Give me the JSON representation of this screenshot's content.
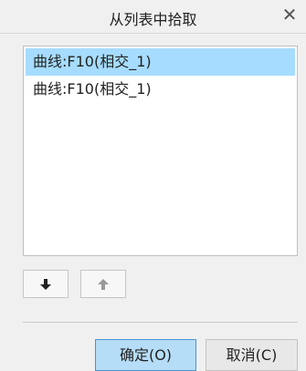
{
  "window": {
    "title": "从列表中拾取",
    "close_icon": "close-icon"
  },
  "list": {
    "items": [
      {
        "label": "曲线:F10(相交_1)",
        "selected": true
      },
      {
        "label": "曲线:F10(相交_1)",
        "selected": false
      }
    ]
  },
  "toolbar": {
    "move_down_icon": "arrow-down-icon",
    "move_up_icon": "arrow-up-icon"
  },
  "buttons": {
    "ok_label": "确定(O)",
    "cancel_label": "取消(C)"
  },
  "colors": {
    "selected_row": "#a6dcff",
    "primary_button": "#b6ddf7",
    "primary_border": "#4a95d2"
  }
}
